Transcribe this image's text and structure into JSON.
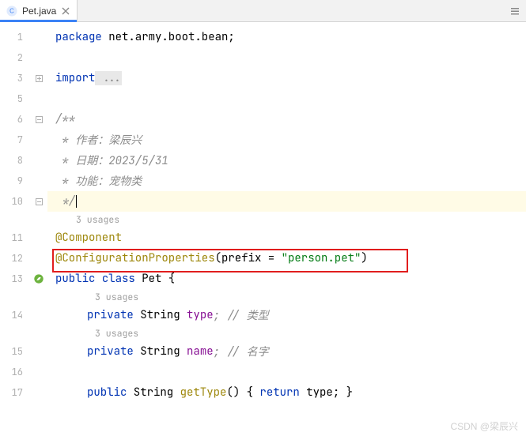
{
  "tab": {
    "filename": "Pet.java"
  },
  "gutter": {
    "lines": [
      "1",
      "2",
      "3",
      "5",
      "6",
      "7",
      "8",
      "9",
      "10",
      "11",
      "12",
      "13",
      "14",
      "15",
      "16",
      "17"
    ]
  },
  "code": {
    "l1_kw": "package",
    "l1_rest": " net.army.boot.bean;",
    "l3_kw": "import",
    "l3_rest": " ...",
    "l6": "/**",
    "l7": " * 作者：梁辰兴",
    "l8": " * 日期：2023/5/31",
    "l9": " * 功能：宠物类",
    "l10": " */",
    "usages3": "3 usages",
    "l11": "@Component",
    "l12_ann": "@ConfigurationProperties",
    "l12_open": "(prefix = ",
    "l12_str": "\"person.pet\"",
    "l12_close": ")",
    "l13_kw1": "public",
    "l13_kw2": "class",
    "l13_name": " Pet {",
    "l14_kw": "private",
    "l14_type": " String ",
    "l14_name": "type",
    "l14_cmt": "; // 类型",
    "l15_kw": "private",
    "l15_type": " String ",
    "l15_name": "name",
    "l15_cmt": "; // 名字",
    "l17_kw": "public",
    "l17_type": " String ",
    "l17_method": "getType",
    "l17_body1": "() { ",
    "l17_ret": "return",
    "l17_body2": " type; }"
  },
  "watermark": "CSDN @梁辰兴"
}
